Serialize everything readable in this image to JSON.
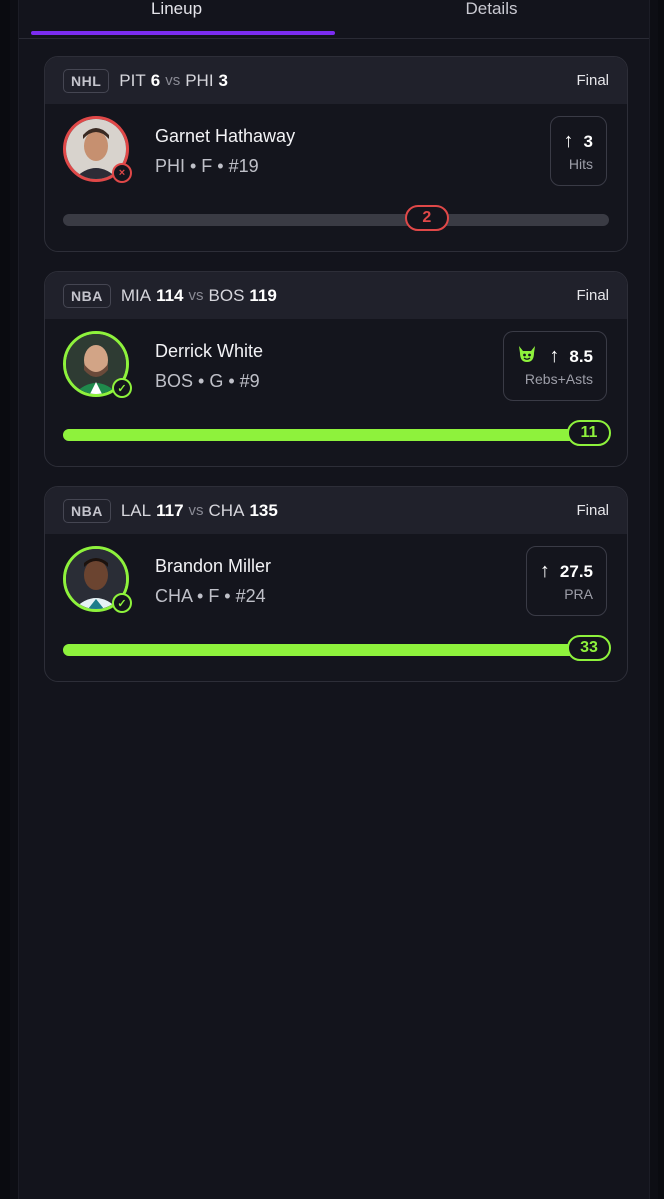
{
  "tabs": {
    "lineup": "Lineup",
    "details": "Details"
  },
  "colors": {
    "accent": "#7b2cf0",
    "win": "#8ef23c",
    "loss": "#e04848"
  },
  "picks": [
    {
      "league": "NHL",
      "away_team": "PIT",
      "away_score": "6",
      "vs": "vs",
      "home_team": "PHI",
      "home_score": "3",
      "status": "Final",
      "player_name": "Garnet Hathaway",
      "player_info": "PHI • F • #19",
      "result": "loss",
      "result_icon": "x-icon",
      "stat_line": "3",
      "stat_label": "Hits",
      "direction_icon": "arrow-up-icon",
      "has_demon": false,
      "actual": "2",
      "progress": 0.67
    },
    {
      "league": "NBA",
      "away_team": "MIA",
      "away_score": "114",
      "vs": "vs",
      "home_team": "BOS",
      "home_score": "119",
      "status": "Final",
      "player_name": "Derrick White",
      "player_info": "BOS • G • #9",
      "result": "win",
      "result_icon": "check-icon",
      "stat_line": "8.5",
      "stat_label": "Rebs+Asts",
      "direction_icon": "arrow-up-icon",
      "has_demon": true,
      "actual": "11",
      "progress": 1.0
    },
    {
      "league": "NBA",
      "away_team": "LAL",
      "away_score": "117",
      "vs": "vs",
      "home_team": "CHA",
      "home_score": "135",
      "status": "Final",
      "player_name": "Brandon Miller",
      "player_info": "CHA • F • #24",
      "result": "win",
      "result_icon": "check-icon",
      "stat_line": "27.5",
      "stat_label": "PRA",
      "direction_icon": "arrow-up-icon",
      "has_demon": false,
      "actual": "33",
      "progress": 1.0
    }
  ]
}
